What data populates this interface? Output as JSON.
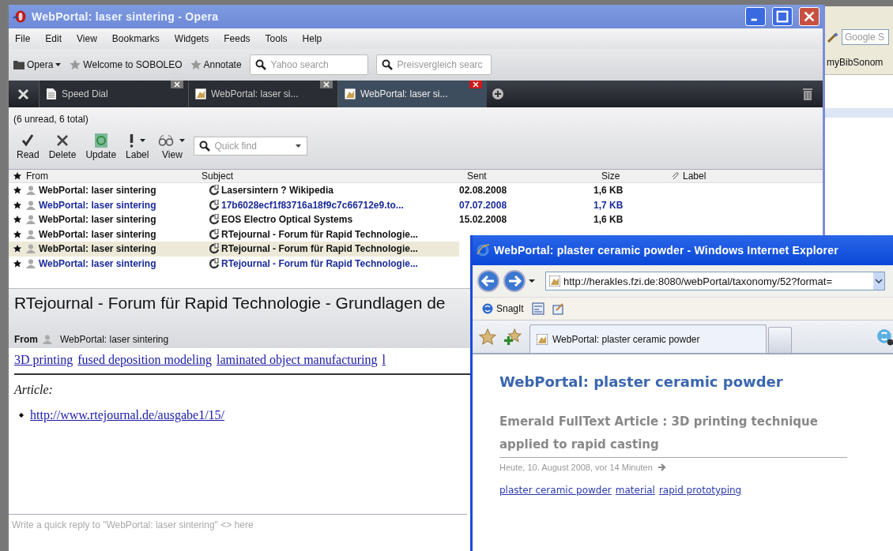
{
  "background_window": {
    "search": {
      "placeholder": "Google S"
    },
    "bookmark": "myBibSonom"
  },
  "opera": {
    "title": "WebPortal: laser sintering - Opera",
    "menu": [
      "File",
      "Edit",
      "View",
      "Bookmarks",
      "Widgets",
      "Feeds",
      "Tools",
      "Help"
    ],
    "bookmarks": [
      {
        "label": "Opera",
        "kind": "folder"
      },
      {
        "label": "Welcome to SOBOLEO",
        "kind": "star"
      },
      {
        "label": "Annotate",
        "kind": "star"
      }
    ],
    "search_fields": [
      {
        "placeholder": "Yahoo search"
      },
      {
        "placeholder": "Preisvergleich searc"
      }
    ],
    "tabs": [
      {
        "label": "Speed Dial",
        "kind": "speed-dial",
        "selected": false
      },
      {
        "label": "WebPortal: laser si...",
        "kind": "page",
        "selected": false
      },
      {
        "label": "WebPortal: laser si...",
        "kind": "page",
        "selected": true
      }
    ],
    "mail": {
      "summary": "(6 unread, 6 total)",
      "toolbar": [
        {
          "label": "Read",
          "kind": "check",
          "has_menu": false
        },
        {
          "label": "Delete",
          "kind": "cross",
          "has_menu": false
        },
        {
          "label": "Update",
          "kind": "update",
          "has_menu": false
        },
        {
          "label": "Label",
          "kind": "exclamation",
          "has_menu": true
        },
        {
          "label": "View",
          "kind": "glasses",
          "has_menu": true
        }
      ],
      "quick_find": {
        "placeholder": "Quick find"
      },
      "columns": [
        "From",
        "Subject",
        "Sent",
        "Size",
        "Label"
      ],
      "messages": [
        {
          "from": "WebPortal: laser sintering",
          "subject": "Lasersintern ? Wikipedia",
          "sent": "02.08.2008",
          "size": "1,6 KB",
          "highlighted": false,
          "selected": false
        },
        {
          "from": "WebPortal: laser sintering",
          "subject": "17b6028ecf1f83716a18f9c7c66712e9.to...",
          "sent": "07.07.2008",
          "size": "1,7 KB",
          "highlighted": true,
          "selected": false
        },
        {
          "from": "WebPortal: laser sintering",
          "subject": "EOS Electro Optical Systems",
          "sent": "15.02.2008",
          "size": "1,6 KB",
          "highlighted": false,
          "selected": false
        },
        {
          "from": "WebPortal: laser sintering",
          "subject": "RTejournal - Forum für Rapid Technologie...",
          "highlighted": false,
          "selected": false
        },
        {
          "from": "WebPortal: laser sintering",
          "subject": "RTejournal - Forum für Rapid Technologie...",
          "highlighted": false,
          "selected": true
        },
        {
          "from": "WebPortal: laser sintering",
          "subject": "RTejournal - Forum für Rapid Technologie...",
          "highlighted": true,
          "selected": false
        }
      ],
      "preview": {
        "subject": "RTejournal - Forum für Rapid Technologie - Grundlagen de",
        "from_label": "From",
        "from": "WebPortal: laser sintering",
        "tags": [
          "3D printing",
          "fused deposition modeling",
          "laminated object manufacturing",
          "l"
        ],
        "article_label": "Article:",
        "links": [
          "http://www.rtejournal.de/ausgabe1/15/"
        ]
      },
      "quick_reply": {
        "placeholder": "Write a quick reply to \"WebPortal: laser sintering\" <> here"
      }
    }
  },
  "ie": {
    "title": "WebPortal: plaster ceramic powder - Windows Internet Explorer",
    "address": "http://herakles.fzi.de:8080/webPortal/taxonomy/52?format=",
    "links_bar": [
      "SnagIt"
    ],
    "tab": {
      "label": "WebPortal: plaster ceramic powder",
      "selected": true
    },
    "page": {
      "heading": "WebPortal: plaster ceramic powder",
      "article_title": "Emerald FullText Article : 3D printing technique applied to rapid casting",
      "date": "Heute, 10. August 2008, vor 14 Minuten",
      "tags": [
        "plaster ceramic powder",
        "material",
        "rapid prototyping"
      ]
    }
  }
}
